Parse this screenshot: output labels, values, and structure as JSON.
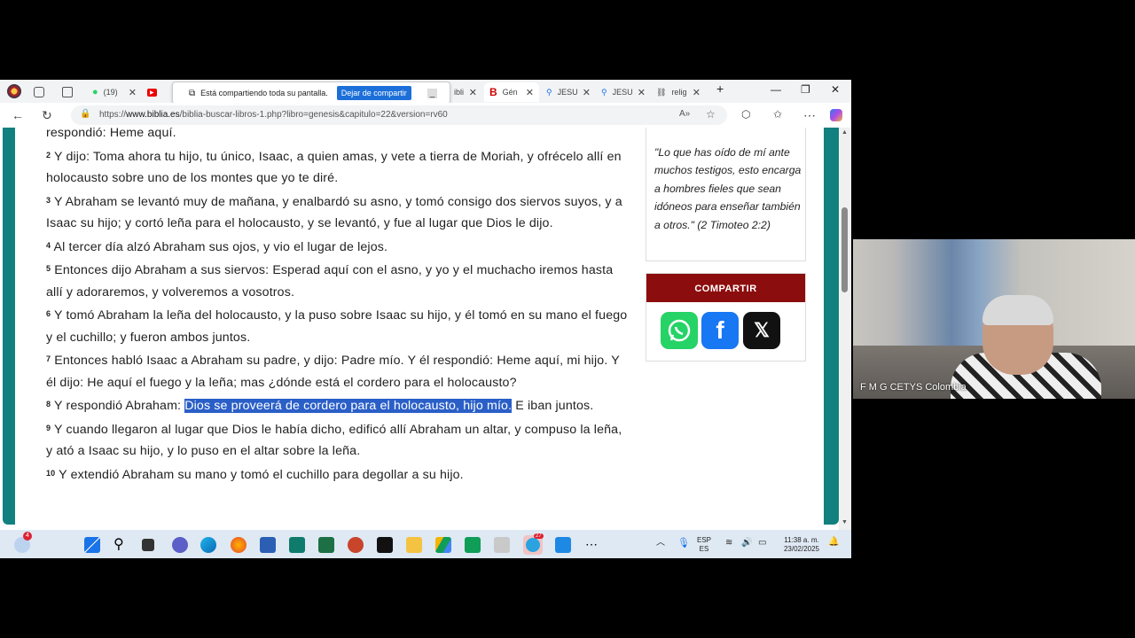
{
  "tabs": [
    {
      "label": "(19)"
    },
    {
      "label": "Está compartiendo toda su pantalla."
    },
    {
      "label": "ibli"
    },
    {
      "label": "Gén"
    },
    {
      "label": "JESU"
    },
    {
      "label": "JESU"
    },
    {
      "label": "relig"
    }
  ],
  "share_bar": {
    "message": "Está compartiendo toda su pantalla.",
    "stop_button": "Dejar de compartir"
  },
  "address": {
    "url_prefix": "https://",
    "url_domain": "www.biblia.es",
    "url_path": "/biblia-buscar-libros-1.php?libro=genesis&capitulo=22&version=rv60"
  },
  "verses": [
    {
      "num": "",
      "text": "respondió: Heme aquí."
    },
    {
      "num": "2",
      "text": "Y dijo: Toma ahora tu hijo, tu único, Isaac, a quien amas, y vete a tierra de Moriah, y ofrécelo allí en holocausto sobre uno de los montes que yo te diré."
    },
    {
      "num": "3",
      "text": "Y Abraham se levantó muy de mañana, y enalbardó su asno, y tomó consigo dos siervos suyos, y a Isaac su hijo; y cortó leña para el holocausto, y se levantó, y fue al lugar que Dios le dijo."
    },
    {
      "num": "4",
      "text": "Al tercer día alzó Abraham sus ojos, y vio el lugar de lejos."
    },
    {
      "num": "5",
      "text": "Entonces dijo Abraham a sus siervos: Esperad aquí con el asno, y yo y el muchacho iremos hasta allí y adoraremos, y volveremos a vosotros."
    },
    {
      "num": "6",
      "text": "Y tomó Abraham la leña del holocausto, y la puso sobre Isaac su hijo, y él tomó en su mano el fuego y el cuchillo; y fueron ambos juntos."
    },
    {
      "num": "7",
      "text": "Entonces habló Isaac a Abraham su padre, y dijo: Padre mío. Y él respondió: Heme aquí, mi hijo. Y él dijo: He aquí el fuego y la leña; mas ¿dónde está el cordero para el holocausto?"
    },
    {
      "num": "9",
      "text": "Y cuando llegaron al lugar que Dios le había dicho, edificó allí Abraham un altar, y compuso la leña, y ató a Isaac su hijo, y lo puso en el altar sobre la leña."
    },
    {
      "num": "10",
      "text": "Y extendió Abraham su mano y tomó el cuchillo para degollar a su hijo."
    }
  ],
  "verse8": {
    "num": "8",
    "before": "Y respondió Abraham: ",
    "highlighted": "Dios se proveerá de cordero para el holocausto, hijo mío.",
    "after": " E iban juntos."
  },
  "sidebar": {
    "quote": "\"Lo que has oído de mí ante muchos testigos, esto encarga a hombres fieles que sean idóneos para enseñar también a otros.\" (2 Timoteo 2:2)",
    "share_title": "COMPARTIR"
  },
  "taskbar": {
    "notification_count": "4",
    "telegram_badge": "27",
    "lang_top": "ESP",
    "lang_bottom": "ES",
    "time": "11:38 a. m.",
    "date": "23/02/2025"
  },
  "webcam": {
    "participant_name": "F M G CETYS Colombia"
  },
  "colors": {
    "teal": "#138080",
    "share_red": "#8c0d0d",
    "highlight": "#2a5fc7",
    "whatsapp": "#25d366",
    "facebook": "#1877f2",
    "x": "#111111"
  }
}
